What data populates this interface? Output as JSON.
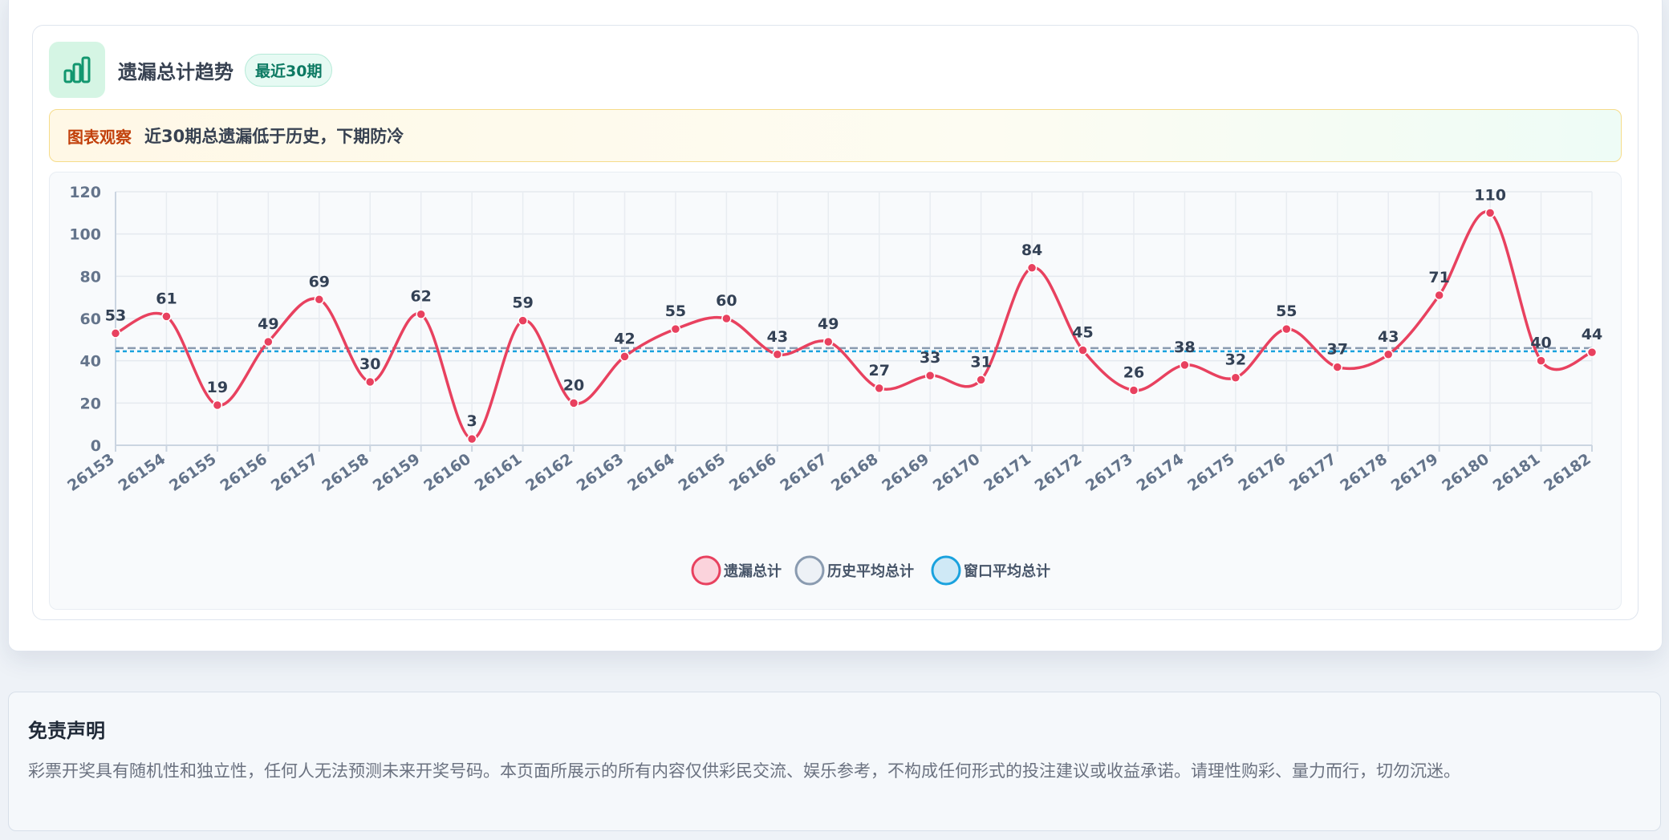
{
  "header": {
    "title": "遗漏总计趋势",
    "badge": "最近30期",
    "icon": "bar-chart-icon"
  },
  "observation": {
    "label": "图表观察",
    "text": "近30期总遗漏低于历史，下期防冷"
  },
  "colors": {
    "series": "#e8415f",
    "history_avg": "#8a9bb0",
    "window_avg": "#1aa2de",
    "accent": "#0d7a63"
  },
  "chart_data": {
    "type": "line",
    "categories": [
      "26153",
      "26154",
      "26155",
      "26156",
      "26157",
      "26158",
      "26159",
      "26160",
      "26161",
      "26162",
      "26163",
      "26164",
      "26165",
      "26166",
      "26167",
      "26168",
      "26169",
      "26170",
      "26171",
      "26172",
      "26173",
      "26174",
      "26175",
      "26176",
      "26177",
      "26178",
      "26179",
      "26180",
      "26181",
      "26182"
    ],
    "series": [
      {
        "name": "遗漏总计",
        "values": [
          53,
          61,
          19,
          49,
          69,
          30,
          62,
          3,
          59,
          20,
          42,
          55,
          60,
          43,
          49,
          27,
          33,
          31,
          84,
          45,
          26,
          38,
          32,
          55,
          37,
          43,
          71,
          110,
          40,
          44
        ]
      },
      {
        "name": "历史平均总计",
        "values": [
          46,
          46,
          46,
          46,
          46,
          46,
          46,
          46,
          46,
          46,
          46,
          46,
          46,
          46,
          46,
          46,
          46,
          46,
          46,
          46,
          46,
          46,
          46,
          46,
          46,
          46,
          46,
          46,
          46,
          46
        ]
      },
      {
        "name": "窗口平均总计",
        "values": [
          44.5,
          44.5,
          44.5,
          44.5,
          44.5,
          44.5,
          44.5,
          44.5,
          44.5,
          44.5,
          44.5,
          44.5,
          44.5,
          44.5,
          44.5,
          44.5,
          44.5,
          44.5,
          44.5,
          44.5,
          44.5,
          44.5,
          44.5,
          44.5,
          44.5,
          44.5,
          44.5,
          44.5,
          44.5,
          44.5
        ]
      }
    ],
    "yticks": [
      0,
      20,
      40,
      60,
      80,
      100,
      120
    ],
    "ylim": [
      0,
      120
    ],
    "grid": true,
    "legend_placement": "bottom-center"
  },
  "disclaimer": {
    "title": "免责声明",
    "text": "彩票开奖具有随机性和独立性，任何人无法预测未来开奖号码。本页面所展示的所有内容仅供彩民交流、娱乐参考，不构成任何形式的投注建议或收益承诺。请理性购彩、量力而行，切勿沉迷。"
  }
}
